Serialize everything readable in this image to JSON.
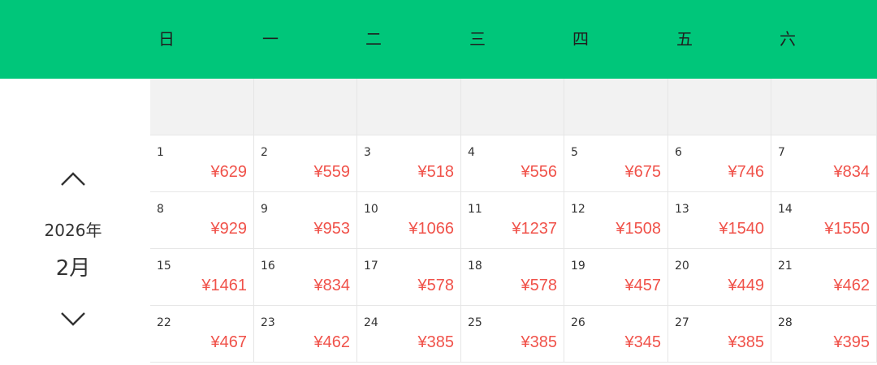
{
  "weekdays": [
    "日",
    "一",
    "二",
    "三",
    "四",
    "五",
    "六"
  ],
  "calendar": {
    "year_label": "2026年",
    "month_label": "2月",
    "prev_icon": "chevron-up-icon",
    "next_icon": "chevron-down-icon",
    "leading_blank_days": 7,
    "days": [
      {
        "day": "1",
        "price": "¥629"
      },
      {
        "day": "2",
        "price": "¥559"
      },
      {
        "day": "3",
        "price": "¥518"
      },
      {
        "day": "4",
        "price": "¥556"
      },
      {
        "day": "5",
        "price": "¥675"
      },
      {
        "day": "6",
        "price": "¥746"
      },
      {
        "day": "7",
        "price": "¥834"
      },
      {
        "day": "8",
        "price": "¥929"
      },
      {
        "day": "9",
        "price": "¥953"
      },
      {
        "day": "10",
        "price": "¥1066"
      },
      {
        "day": "11",
        "price": "¥1237"
      },
      {
        "day": "12",
        "price": "¥1508"
      },
      {
        "day": "13",
        "price": "¥1540"
      },
      {
        "day": "14",
        "price": "¥1550"
      },
      {
        "day": "15",
        "price": "¥1461"
      },
      {
        "day": "16",
        "price": "¥834"
      },
      {
        "day": "17",
        "price": "¥578"
      },
      {
        "day": "18",
        "price": "¥578"
      },
      {
        "day": "19",
        "price": "¥457"
      },
      {
        "day": "20",
        "price": "¥449"
      },
      {
        "day": "21",
        "price": "¥462"
      },
      {
        "day": "22",
        "price": "¥467"
      },
      {
        "day": "23",
        "price": "¥462"
      },
      {
        "day": "24",
        "price": "¥385"
      },
      {
        "day": "25",
        "price": "¥385"
      },
      {
        "day": "26",
        "price": "¥345"
      },
      {
        "day": "27",
        "price": "¥385"
      },
      {
        "day": "28",
        "price": "¥395"
      }
    ]
  },
  "colors": {
    "header_bg": "#00c67a",
    "price": "#f0524a",
    "blank_cell": "#f2f2f2"
  }
}
